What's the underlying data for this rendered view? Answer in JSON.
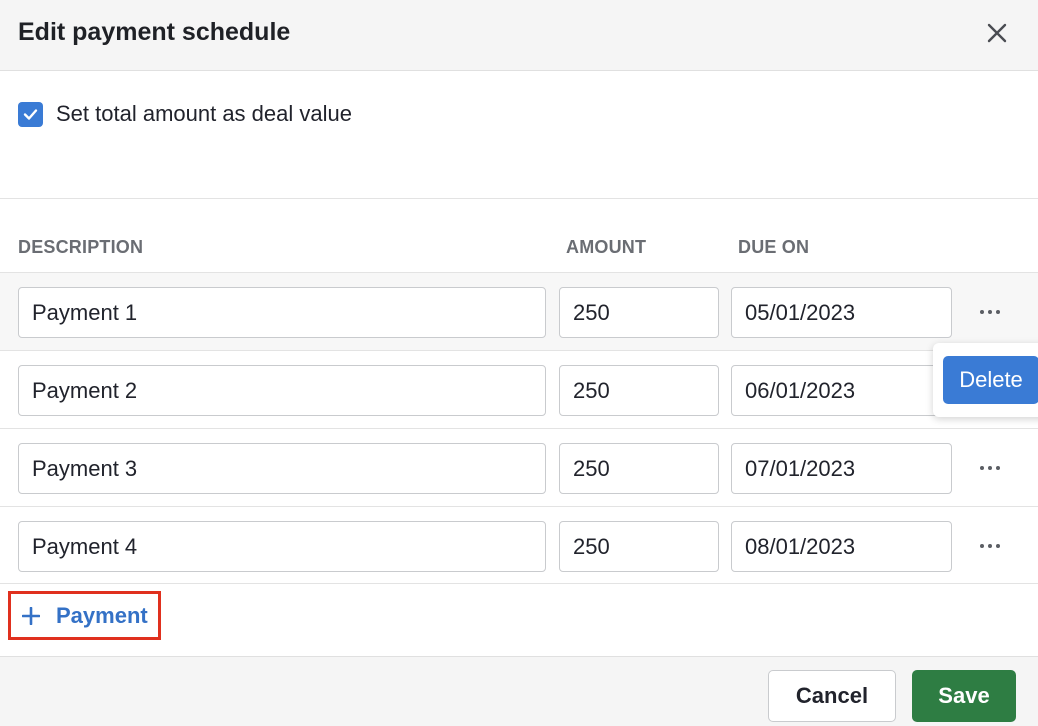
{
  "dialog": {
    "title": "Edit payment schedule"
  },
  "options": {
    "set_total_label": "Set total amount as deal value",
    "set_total_checked": true
  },
  "table": {
    "headers": {
      "description": "DESCRIPTION",
      "amount": "AMOUNT",
      "due_on": "DUE ON"
    },
    "rows": [
      {
        "description": "Payment 1",
        "amount": "250",
        "due_on": "05/01/2023"
      },
      {
        "description": "Payment 2",
        "amount": "250",
        "due_on": "06/01/2023"
      },
      {
        "description": "Payment 3",
        "amount": "250",
        "due_on": "07/01/2023"
      },
      {
        "description": "Payment 4",
        "amount": "250",
        "due_on": "08/01/2023"
      }
    ]
  },
  "row_menu": {
    "delete_label": "Delete"
  },
  "add_payment": {
    "label": "Payment",
    "icon": "plus-icon"
  },
  "footer": {
    "cancel_label": "Cancel",
    "save_label": "Save"
  },
  "colors": {
    "accent": "#3a7bd5",
    "link": "#3471c6",
    "save": "#2e7d43",
    "highlight": "#e0301e"
  }
}
